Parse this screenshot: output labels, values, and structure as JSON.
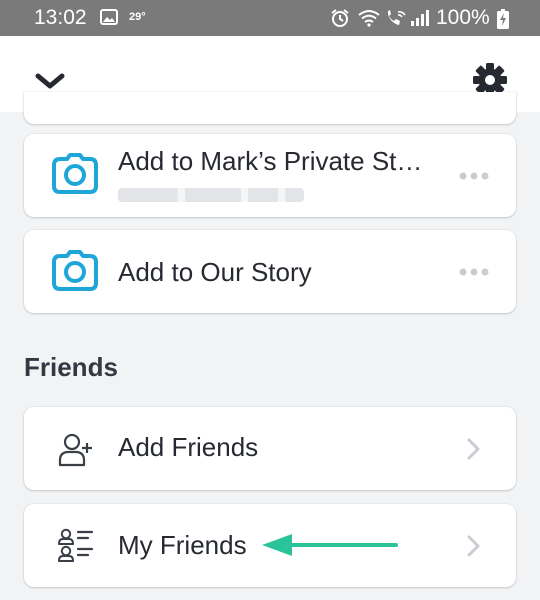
{
  "status_bar": {
    "time": "13:02",
    "temperature": "29°",
    "battery": "100%",
    "icons": [
      "gallery-icon",
      "alarm-icon",
      "wifi-icon",
      "wifi-calling-icon",
      "signal-icon",
      "battery-charging-icon"
    ],
    "background": "#7a7a7a"
  },
  "header": {
    "left_icon": "chevron-down-icon",
    "right_icon": "gear-icon"
  },
  "stories": [
    {
      "title": "Add to Mark’s Private St…",
      "subtitle": "",
      "icon": "camera-icon",
      "action_icon": "more-icon"
    },
    {
      "title": "Add to Our Story",
      "icon": "camera-icon",
      "action_icon": "more-icon"
    }
  ],
  "friends_section": {
    "title": "Friends",
    "items": [
      {
        "label": "Add Friends",
        "icon": "add-friend-icon",
        "action_icon": "chevron-right-icon"
      },
      {
        "label": "My Friends",
        "icon": "friends-list-icon",
        "action_icon": "chevron-right-icon"
      }
    ]
  },
  "annotation": {
    "icon": "arrow-left-icon",
    "color": "#2bc49a"
  },
  "colors": {
    "accent": "#1ea6d9",
    "page_bg": "#f2f3f5",
    "card_bg": "#ffffff",
    "text": "#262a30"
  }
}
